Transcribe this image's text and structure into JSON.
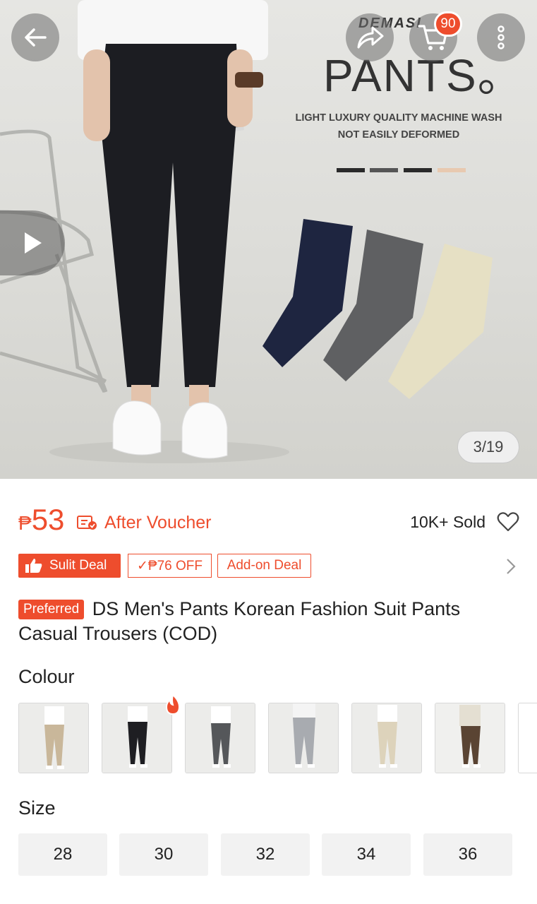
{
  "hero": {
    "brand": "DEMASI",
    "title": "PANTS。",
    "subtitle_line1": "LIGHT LUXURY QUALITY MACHINE WASH",
    "subtitle_line2": "NOT EASILY DEFORMED",
    "cart_count": "90",
    "image_counter": "3/19"
  },
  "icons": {
    "back": "arrow-left-icon",
    "share": "share-icon",
    "cart": "cart-icon",
    "more": "more-vertical-icon",
    "play": "play-icon",
    "voucher": "voucher-icon",
    "heart": "heart-icon",
    "chevron": "chevron-right-icon",
    "flame": "flame-icon"
  },
  "price": {
    "currency": "₱",
    "amount": "53",
    "after_voucher": "After Voucher",
    "sold": "10K+ Sold"
  },
  "tags": {
    "sulit": "Sulit Deal",
    "off": "✓₱76 OFF",
    "addon": "Add-on Deal"
  },
  "product": {
    "badge": "Preferred",
    "title": "DS Men's Pants Korean Fashion Suit Pants Casual Trousers (COD)"
  },
  "colour": {
    "label": "Colour",
    "swatches": [
      "khaki",
      "black",
      "dark-grey",
      "light-grey",
      "beige",
      "brown"
    ]
  },
  "size": {
    "label": "Size",
    "options": [
      "28",
      "30",
      "32",
      "34",
      "36"
    ]
  },
  "colors": {
    "accent": "#ee4d2d"
  }
}
